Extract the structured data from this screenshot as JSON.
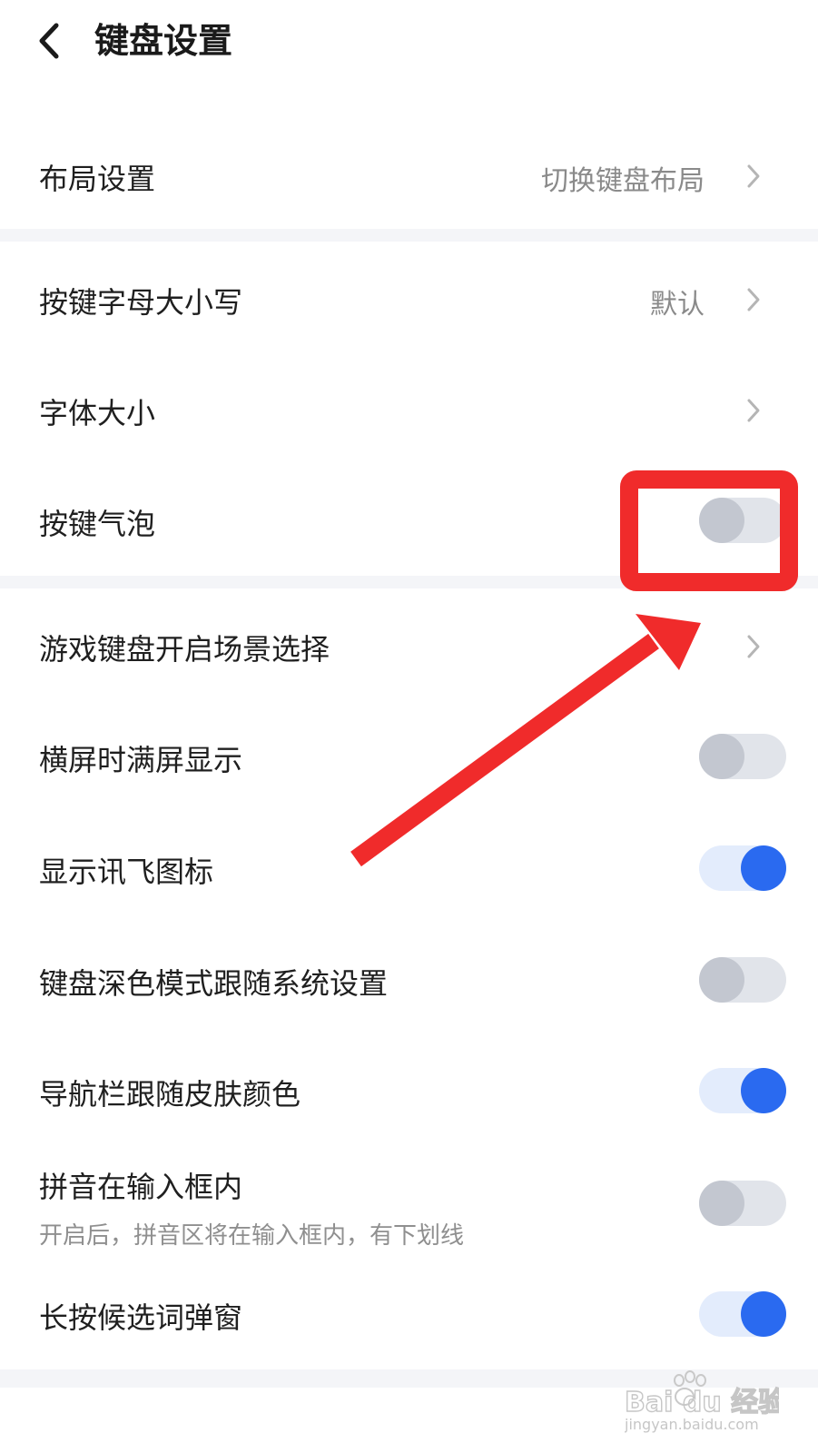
{
  "header": {
    "title": "键盘设置"
  },
  "rows": {
    "layout": {
      "label": "布局设置",
      "value": "切换键盘布局"
    },
    "case": {
      "label": "按键字母大小写",
      "value": "默认"
    },
    "font_size": {
      "label": "字体大小"
    },
    "bubble": {
      "label": "按键气泡",
      "state": "off"
    },
    "game": {
      "label": "游戏键盘开启场景选择"
    },
    "landscape": {
      "label": "横屏时满屏显示",
      "state": "off"
    },
    "xunfei_icon": {
      "label": "显示讯飞图标",
      "state": "on"
    },
    "dark_mode": {
      "label": "键盘深色模式跟随系统设置",
      "state": "off"
    },
    "navbar": {
      "label": "导航栏跟随皮肤颜色",
      "state": "on"
    },
    "pinyin_in_box": {
      "label": "拼音在输入框内",
      "subtitle": "开启后，拼音区将在输入框内，有下划线",
      "state": "off"
    },
    "long_press": {
      "label": "长按候选词弹窗",
      "state": "on"
    }
  },
  "watermark": {
    "brand": "Bai du 经验",
    "url": "jingyan.baidu.com"
  },
  "colors": {
    "accent": "#2a6af0",
    "annotation": "#f02b2b"
  }
}
